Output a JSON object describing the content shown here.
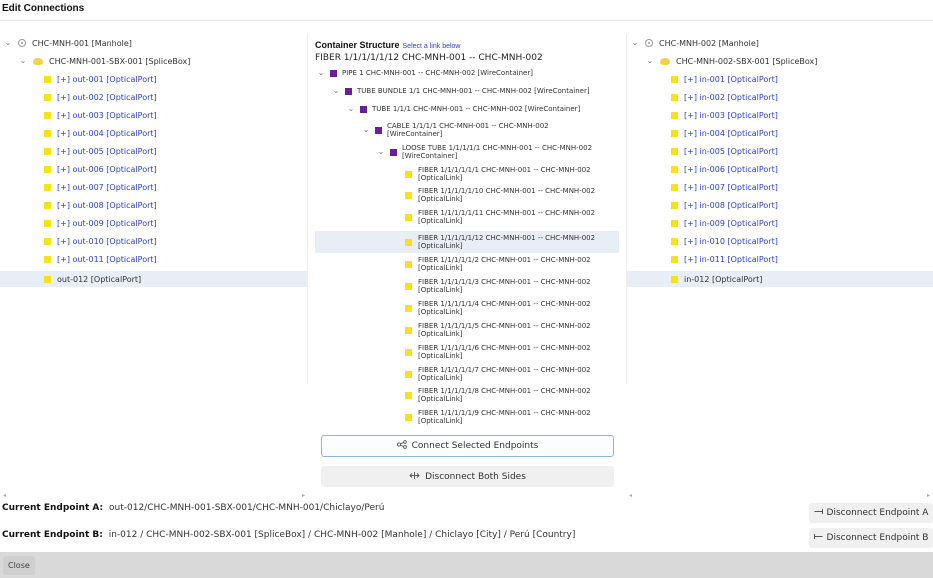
{
  "title": "Edit Connections",
  "left": {
    "manhole": "CHC-MNH-001 [Manhole]",
    "splicebox": "CHC-MNH-001-SBX-001 [SpliceBox]",
    "ports": [
      "[+] out-001 [OpticalPort]",
      "[+] out-002 [OpticalPort]",
      "[+] out-003 [OpticalPort]",
      "[+] out-004 [OpticalPort]",
      "[+] out-005 [OpticalPort]",
      "[+] out-006 [OpticalPort]",
      "[+] out-007 [OpticalPort]",
      "[+] out-008 [OpticalPort]",
      "[+] out-009 [OpticalPort]",
      "[+] out-010 [OpticalPort]",
      "[+] out-011 [OpticalPort]",
      "out-012 [OpticalPort]"
    ]
  },
  "center": {
    "heading": "Container Structure",
    "hint": "Select a link below",
    "path": "FIBER 1/1/1/1/1/12 CHC-MNH-001 -- CHC-MNH-002",
    "pipe": "PIPE 1 CHC-MNH-001 -- CHC-MNH-002 [WireContainer]",
    "tube_bundle": "TUBE BUNDLE 1/1 CHC-MNH-001 -- CHC-MNH-002 [WireContainer]",
    "tube": "TUBE 1/1/1 CHC-MNH-001 -- CHC-MNH-002 [WireContainer]",
    "cable_l1": "CABLE 1/1/1/1 CHC-MNH-001 -- CHC-MNH-002",
    "cable_l2": "[WireContainer]",
    "loose_l1": "LOOSE TUBE 1/1/1/1/1 CHC-MNH-001 -- CHC-MNH-002",
    "loose_l2": "[WireContainer]",
    "fibers": [
      "FIBER 1/1/1/1/1/1 CHC-MNH-001 -- CHC-MNH-002",
      "FIBER 1/1/1/1/1/10 CHC-MNH-001 -- CHC-MNH-002",
      "FIBER 1/1/1/1/1/11 CHC-MNH-001 -- CHC-MNH-002",
      "FIBER 1/1/1/1/1/12 CHC-MNH-001 -- CHC-MNH-002",
      "FIBER 1/1/1/1/1/2 CHC-MNH-001 -- CHC-MNH-002",
      "FIBER 1/1/1/1/1/3 CHC-MNH-001 -- CHC-MNH-002",
      "FIBER 1/1/1/1/1/4 CHC-MNH-001 -- CHC-MNH-002",
      "FIBER 1/1/1/1/1/5 CHC-MNH-001 -- CHC-MNH-002",
      "FIBER 1/1/1/1/1/6 CHC-MNH-001 -- CHC-MNH-002",
      "FIBER 1/1/1/1/1/7 CHC-MNH-001 -- CHC-MNH-002",
      "FIBER 1/1/1/1/1/8 CHC-MNH-001 -- CHC-MNH-002",
      "FIBER 1/1/1/1/1/9 CHC-MNH-001 -- CHC-MNH-002"
    ],
    "fiber_suffix": "[OpticalLink]"
  },
  "right": {
    "manhole": "CHC-MNH-002 [Manhole]",
    "splicebox": "CHC-MNH-002-SBX-001 [SpliceBox]",
    "ports": [
      "[+] in-001 [OpticalPort]",
      "[+] in-002 [OpticalPort]",
      "[+] in-003 [OpticalPort]",
      "[+] in-004 [OpticalPort]",
      "[+] in-005 [OpticalPort]",
      "[+] in-006 [OpticalPort]",
      "[+] in-007 [OpticalPort]",
      "[+] in-008 [OpticalPort]",
      "[+] in-009 [OpticalPort]",
      "[+] in-010 [OpticalPort]",
      "[+] in-011 [OpticalPort]",
      "in-012 [OpticalPort]"
    ]
  },
  "buttons": {
    "connect": "Connect Selected Endpoints",
    "disconnect_both": "Disconnect Both Sides",
    "disconnect_a": "Disconnect Endpoint A",
    "disconnect_b": "Disconnect Endpoint B",
    "close": "Close"
  },
  "endpoints": {
    "a_label": "Current Endpoint A:",
    "a_value": "out-012/CHC-MNH-001-SBX-001/CHC-MNH-001/Chiclayo/Perú",
    "b_label": "Current Endpoint B:",
    "b_value": "in-012 / CHC-MNH-002-SBX-001 [SpliceBox] / CHC-MNH-002 [Manhole] / Chiclayo [City] / Perú [Country]"
  },
  "colors": {
    "port_yellow": "#f5e21a",
    "container_purple": "#6a1e9e",
    "link_blue": "#2a3fd0",
    "selection": "#e8eef6"
  }
}
